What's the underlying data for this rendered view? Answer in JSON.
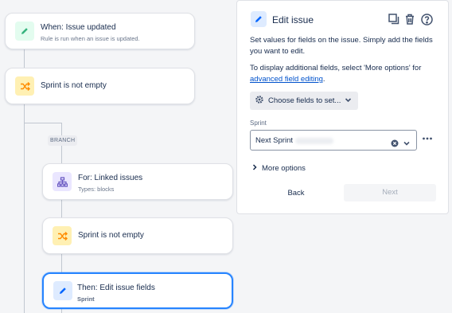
{
  "flow": {
    "trigger": {
      "title": "When: Issue updated",
      "subtitle": "Rule is run when an issue is updated."
    },
    "condition1": {
      "title": "Sprint is not empty"
    },
    "branch_label": "BRANCH",
    "branch_for": {
      "title": "For: Linked issues",
      "subtitle": "Types: blocks"
    },
    "condition2": {
      "title": "Sprint is not empty"
    },
    "action": {
      "title": "Then: Edit issue fields",
      "subtitle": "Sprint"
    }
  },
  "panel": {
    "title": "Edit issue",
    "desc1": "Set values for fields on the issue. Simply add the fields you want to edit.",
    "desc2_prefix": "To display additional fields, select 'More options' for",
    "desc2_link": "advanced field editing",
    "desc2_suffix": ".",
    "choose_fields_label": "Choose fields to set...",
    "field_label": "Sprint",
    "field_value": "Next Sprint",
    "more_options_label": "More options",
    "back_label": "Back",
    "next_label": "Next"
  },
  "colors": {
    "accent": "#0052cc",
    "selected_border": "#2684ff",
    "trigger_icon": "#36b37e",
    "condition_icon": "#ff8b00",
    "branch_icon": "#6554c0",
    "action_icon": "#0065ff"
  },
  "icons": {
    "trigger": "pencil-icon",
    "condition": "shuffle-icon",
    "branch": "hierarchy-icon",
    "action": "pencil-icon",
    "panel_tools": [
      "copy-icon",
      "trash-icon",
      "help-icon"
    ],
    "choose_fields": "gear-icon",
    "select_clear": "clear-icon",
    "select_chevron": "chevron-down-icon",
    "field_more": "more-dots-icon",
    "more_options": "chevron-right-icon"
  }
}
